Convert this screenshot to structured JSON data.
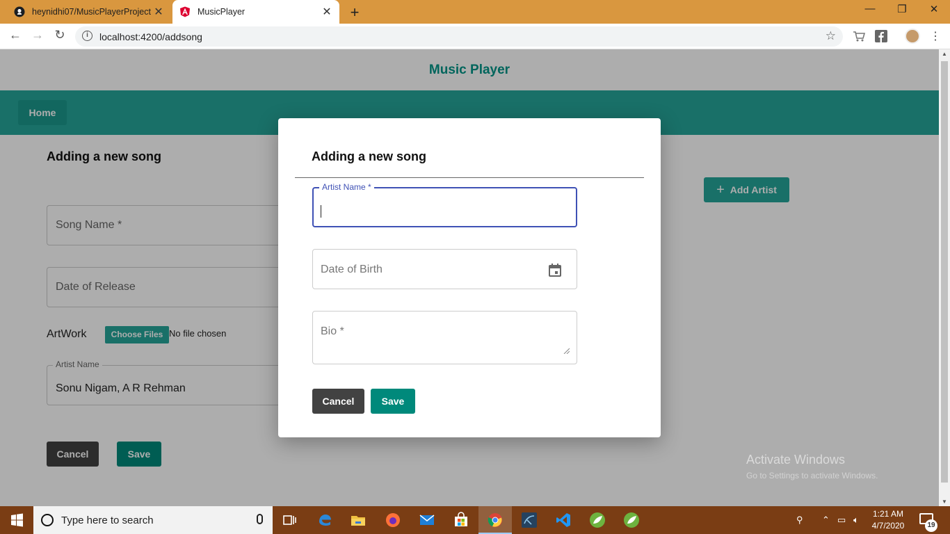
{
  "browser": {
    "tabs": [
      {
        "title": "heynidhi07/MusicPlayerProject",
        "active": false
      },
      {
        "title": "MusicPlayer",
        "active": true
      }
    ],
    "url": "localhost:4200/addsong"
  },
  "app": {
    "title": "Music Player",
    "nav": {
      "home_label": "Home"
    },
    "page": {
      "heading": "Adding a new song",
      "song_name_placeholder": "Song Name *",
      "date_of_release_placeholder": "Date of Release",
      "artwork_label": "ArtWork",
      "choose_files_label": "Choose Files",
      "no_file_text": "No file chosen",
      "artist_name_label": "Artist Name",
      "artist_name_value": "Sonu Nigam, A R Rehman",
      "cancel_label": "Cancel",
      "save_label": "Save",
      "add_artist_label": "Add Artist"
    }
  },
  "dialog": {
    "title": "Adding a new song",
    "artist_name_label": "Artist Name *",
    "artist_name_value": "",
    "dob_placeholder": "Date of Birth",
    "bio_placeholder": "Bio *",
    "cancel_label": "Cancel",
    "save_label": "Save"
  },
  "watermark": {
    "line1": "Activate Windows",
    "line2": "Go to Settings to activate Windows."
  },
  "taskbar": {
    "search_placeholder": "Type here to search",
    "time": "1:21 AM",
    "date": "4/7/2020",
    "notification_count": "19"
  },
  "colors": {
    "accent": "#26a69a",
    "title": "#009688",
    "focus": "#3f51b5",
    "tabbar": "#d9973f",
    "taskbar": "#7a3d14"
  }
}
